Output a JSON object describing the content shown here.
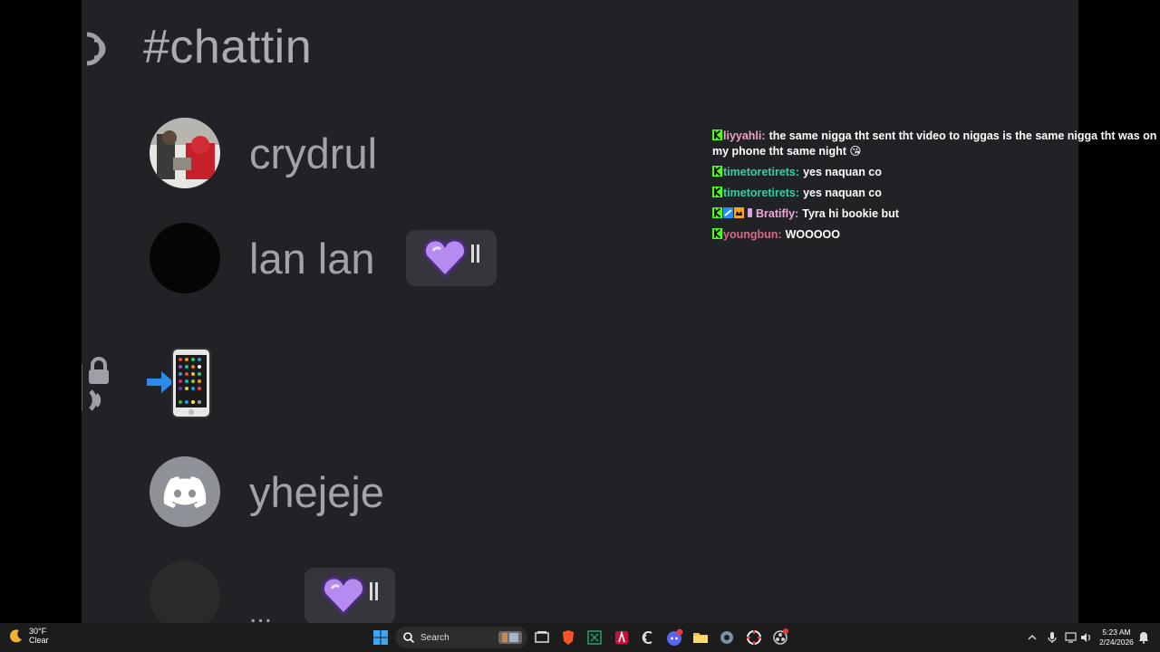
{
  "discord": {
    "channel_name": "#chattin",
    "users": [
      {
        "name": "crydrul"
      },
      {
        "name": "lan lan"
      },
      {
        "name": "yhejeje"
      },
      {
        "name": "..."
      }
    ]
  },
  "chat": {
    "messages": [
      {
        "user": "liyyahli",
        "color": "#f39fc1",
        "text": "the same nigga tht sent tht video to niggas is the same nigga tht was on my phone tht same night 😘"
      },
      {
        "user": "timetoretirets",
        "color": "#2ed3a0",
        "text": "yes naquan co"
      },
      {
        "user": "timetoretirets",
        "color": "#2ed3a0",
        "text": "yes naquan co"
      },
      {
        "user": "Bratifly",
        "color": "#f0a8d8",
        "text": "Tyra hi bookie but"
      },
      {
        "user": "youngbun",
        "color": "#d56a8a",
        "text": "WOOOOO"
      }
    ]
  },
  "taskbar": {
    "weather_temp": "30°F",
    "weather_cond": "Clear",
    "search_label": "Search",
    "time": "5:23 AM",
    "date": "2/24/2026",
    "icons": [
      "windows-start-icon",
      "search-icon",
      "task-view-icon",
      "brave-browser-icon",
      "excel-icon",
      "app-red-icon",
      "app-back-icon",
      "discord-icon",
      "file-explorer-icon",
      "settings-icon",
      "capture-icon",
      "obs-icon"
    ]
  },
  "colors": {
    "discord_bg": "#202226",
    "taskbar_bg": "#1c1c1c",
    "kick_green": "#53fc18"
  }
}
